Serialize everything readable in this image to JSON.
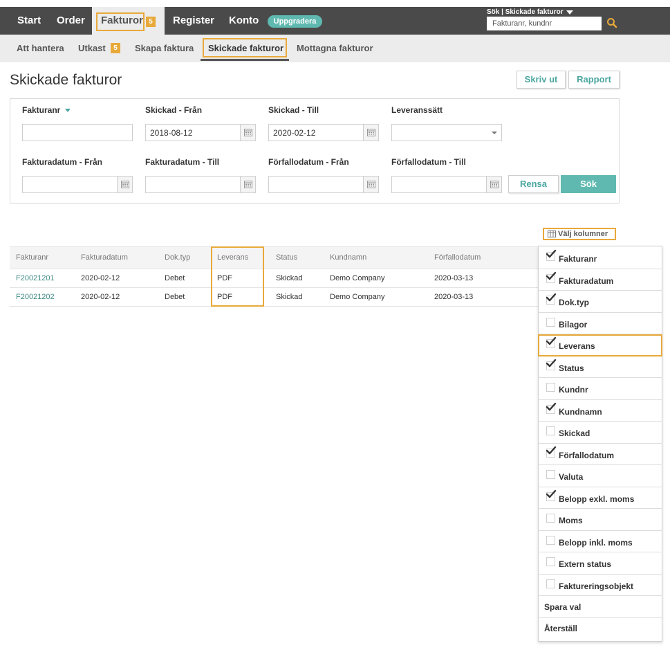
{
  "topnav": {
    "items": [
      "Start",
      "Order",
      "Fakturor",
      "Register",
      "Konto"
    ],
    "fakturor_badge": "5",
    "upgrade_label": "Uppgradera",
    "search_label": "Sök | Skickade fakturor",
    "search_placeholder": "Fakturanr, kundnr"
  },
  "subnav": {
    "items": [
      "Att hantera",
      "Utkast",
      "Skapa faktura",
      "Skickade fakturor",
      "Mottagna fakturor"
    ],
    "utkast_badge": "5",
    "active": "Skickade fakturor"
  },
  "page": {
    "title": "Skickade fakturor",
    "print_label": "Skriv ut",
    "report_label": "Rapport"
  },
  "filters": {
    "fakturanr_label": "Fakturanr",
    "skickad_fran_label": "Skickad - Från",
    "skickad_fran_value": "2018-08-12",
    "skickad_till_label": "Skickad - Till",
    "skickad_till_value": "2020-02-12",
    "leveranssatt_label": "Leveranssätt",
    "fakturadatum_fran_label": "Fakturadatum - Från",
    "fakturadatum_till_label": "Fakturadatum - Till",
    "forfallodatum_fran_label": "Förfallodatum - Från",
    "forfallodatum_till_label": "Förfallodatum - Till",
    "clear_label": "Rensa",
    "search_label": "Sök"
  },
  "choose_columns_label": "Välj kolumner",
  "table": {
    "headers": [
      "Fakturanr",
      "Fakturadatum",
      "Dok.typ",
      "Leverans",
      "Status",
      "Kundnamn",
      "Förfallodatum"
    ],
    "rows": [
      [
        "F20021201",
        "2020-02-12",
        "Debet",
        "PDF",
        "Skickad",
        "Demo Company",
        "2020-03-13"
      ],
      [
        "F20021202",
        "2020-02-12",
        "Debet",
        "PDF",
        "Skickad",
        "Demo Company",
        "2020-03-13"
      ]
    ]
  },
  "column_chooser": {
    "options": [
      {
        "label": "Fakturanr",
        "checked": true
      },
      {
        "label": "Fakturadatum",
        "checked": true
      },
      {
        "label": "Dok.typ",
        "checked": true
      },
      {
        "label": "Bilagor",
        "checked": false
      },
      {
        "label": "Leverans",
        "checked": true
      },
      {
        "label": "Status",
        "checked": true
      },
      {
        "label": "Kundnr",
        "checked": false
      },
      {
        "label": "Kundnamn",
        "checked": true
      },
      {
        "label": "Skickad",
        "checked": false
      },
      {
        "label": "Förfallodatum",
        "checked": true
      },
      {
        "label": "Valuta",
        "checked": false
      },
      {
        "label": "Belopp exkl. moms",
        "checked": true
      },
      {
        "label": "Moms",
        "checked": false
      },
      {
        "label": "Belopp inkl. moms",
        "checked": false
      },
      {
        "label": "Extern status",
        "checked": false
      },
      {
        "label": "Faktureringsobjekt",
        "checked": false
      }
    ],
    "save_label": "Spara val",
    "reset_label": "Återställ"
  },
  "colors": {
    "accent": "#5fb9b0",
    "highlight": "#e8a93a",
    "nav_bg": "#4a4a4a"
  }
}
